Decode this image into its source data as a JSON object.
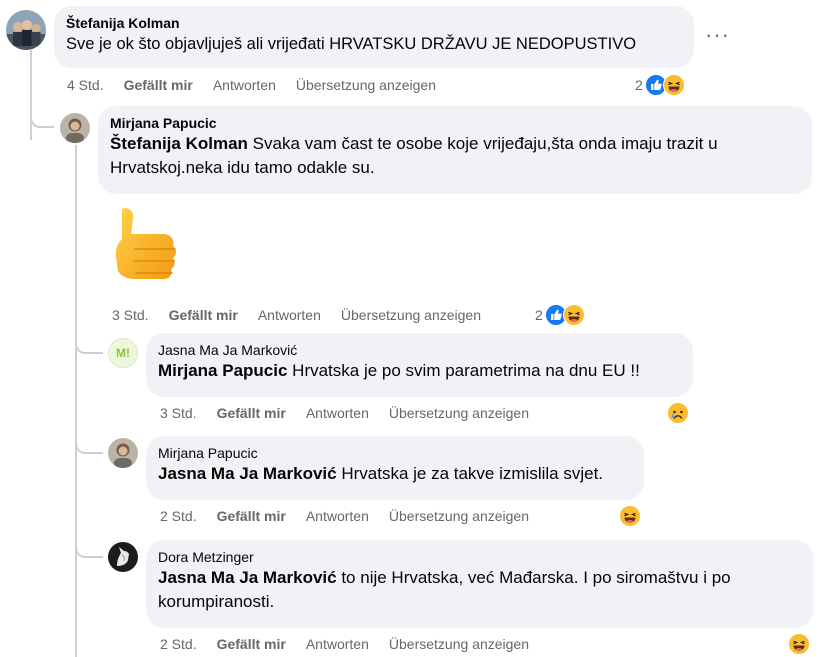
{
  "meta_labels": {
    "like": "Gefällt mir",
    "reply": "Antworten",
    "translate": "Übersetzung anzeigen"
  },
  "more_options_glyph": "···",
  "comments": [
    {
      "author": "Štefanija Kolman",
      "text": "Sve je ok što objavljuješ ali vrijeđati HRVATSKU DRŽAVU JE NEDOPUSTIVO",
      "time": "4 Std.",
      "reaction_count": "2",
      "reactions": [
        "like-icon",
        "laughing-face-icon"
      ]
    },
    {
      "author": "Mirjana Papucic",
      "mention": "Štefanija Kolman",
      "text": " Svaka vam čast te osobe koje vrijeđaju,šta onda imaju trazit u Hrvatskoj.neka idu tamo odakle su.",
      "sticker": "thumbs-up-icon",
      "time": "3 Std.",
      "reaction_count": "2",
      "reactions": [
        "like-icon",
        "laughing-face-icon"
      ]
    },
    {
      "author": "Jasna Ma Ja Marković",
      "avatar_text": "M!",
      "mention": "Mirjana Papucic",
      "text": " Hrvatska je po svim parametrima na dnu EU !!",
      "time": "3 Std.",
      "reactions": [
        "sad-face-icon"
      ]
    },
    {
      "author": "Mirjana Papucic",
      "mention": "Jasna Ma Ja Marković",
      "text": " Hrvatska je za takve izmislila svjet.",
      "time": "2 Std.",
      "reactions": [
        "laughing-face-icon"
      ]
    },
    {
      "author": "Dora Metzinger",
      "mention": "Jasna Ma Ja Marković",
      "text": " to nije Hrvatska, već Mađarska. I po siromaštvu i po korumpiranosti.",
      "time": "2 Std.",
      "reactions": [
        "laughing-face-icon"
      ]
    }
  ],
  "colors": {
    "bubble": "#f0f2f5",
    "meta_text": "#65676b",
    "like_blue": "#1877f2",
    "thread_line": "#ccd0d5",
    "emoji_yellow": "#fbbd30"
  }
}
